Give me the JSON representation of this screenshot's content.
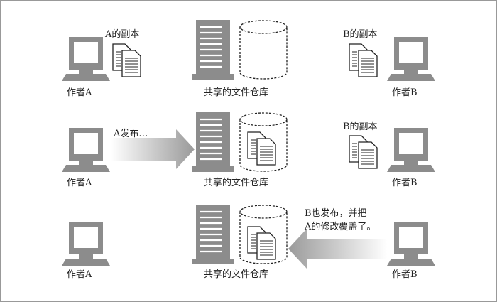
{
  "colors": {
    "device_gray": "#8c8c8c",
    "arrow_gray": "#9a9a9a",
    "border": "#999999"
  },
  "rows": [
    {
      "author_a": "作者A",
      "author_b": "作者B",
      "repo": "共享的文件仓库",
      "copy_a": "A的副本",
      "copy_b": "B的副本"
    },
    {
      "author_a": "作者A",
      "author_b": "作者B",
      "repo": "共享的文件仓库",
      "arrow_label": "A发布…",
      "copy_b": "B的副本"
    },
    {
      "author_a": "作者A",
      "author_b": "作者B",
      "repo": "共享的文件仓库",
      "arrow_label_line1": "B也发布，并把",
      "arrow_label_line2": "A的修改覆盖了。"
    }
  ]
}
